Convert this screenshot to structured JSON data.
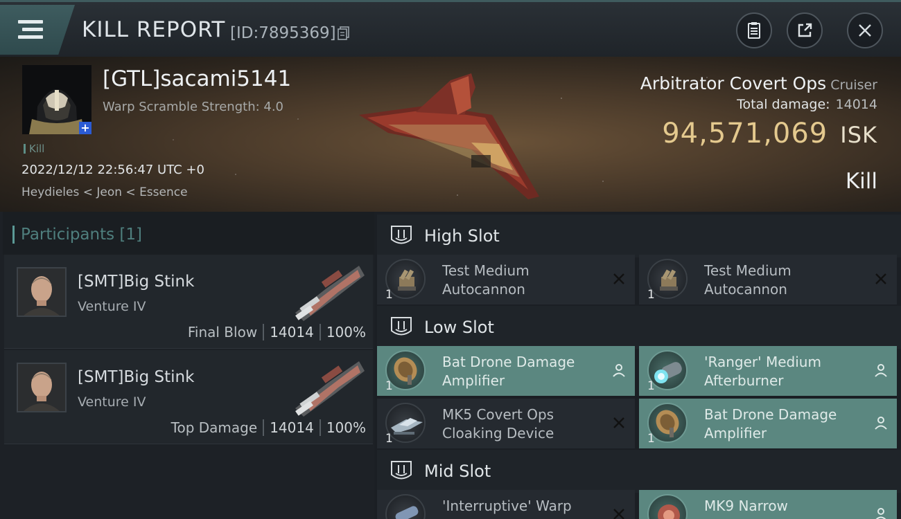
{
  "header": {
    "title": "KILL REPORT",
    "report_id": "[ID:7895369]"
  },
  "hero": {
    "pilot_name": "[GTL]sacami5141",
    "warp_scramble": "Warp Scramble Strength: 4.0",
    "kill_tag": "Kill",
    "datetime": "2022/12/12 22:56:47 UTC +0",
    "location": "Heydieles < Jeon < Essence",
    "ship_name": "Arbitrator Covert Ops",
    "ship_class": "Cruiser",
    "total_damage_label": "Total damage:",
    "total_damage_value": "14014",
    "isk_value": "94,571,069",
    "isk_unit": "ISK",
    "result": "Kill"
  },
  "participants": {
    "title": "Participants",
    "count": "[1]",
    "rows": [
      {
        "name": "[SMT]Big Stink",
        "ship": "Venture IV",
        "role": "Final Blow",
        "damage": "14014",
        "percent": "100%"
      },
      {
        "name": "[SMT]Big Stink",
        "ship": "Venture IV",
        "role": "Top Damage",
        "damage": "14014",
        "percent": "100%"
      }
    ]
  },
  "slots": {
    "high": {
      "title": "High Slot",
      "modules": [
        {
          "name": "Test Medium Autocannon",
          "qty": "1",
          "state": "destroyed"
        },
        {
          "name": "Test Medium Autocannon",
          "qty": "1",
          "state": "destroyed"
        }
      ]
    },
    "low": {
      "title": "Low Slot",
      "modules": [
        {
          "name": "Bat Drone Damage Amplifier",
          "qty": "1",
          "state": "dropped"
        },
        {
          "name": "'Ranger' Medium Afterburner",
          "qty": "1",
          "state": "dropped"
        },
        {
          "name": "MK5 Covert Ops Cloaking Device",
          "qty": "1",
          "state": "destroyed"
        },
        {
          "name": "Bat Drone Damage Amplifier",
          "qty": "1",
          "state": "dropped"
        }
      ]
    },
    "mid": {
      "title": "Mid Slot",
      "modules": [
        {
          "name": "'Interruptive' Warp",
          "qty": "1",
          "state": "destroyed"
        },
        {
          "name": "MK9 Narrow",
          "qty": "1",
          "state": "dropped"
        }
      ]
    }
  },
  "colors": {
    "accent_teal": "#5b8780",
    "isk_gold": "#e4c98e",
    "header_tab": "#3e5c5f"
  }
}
